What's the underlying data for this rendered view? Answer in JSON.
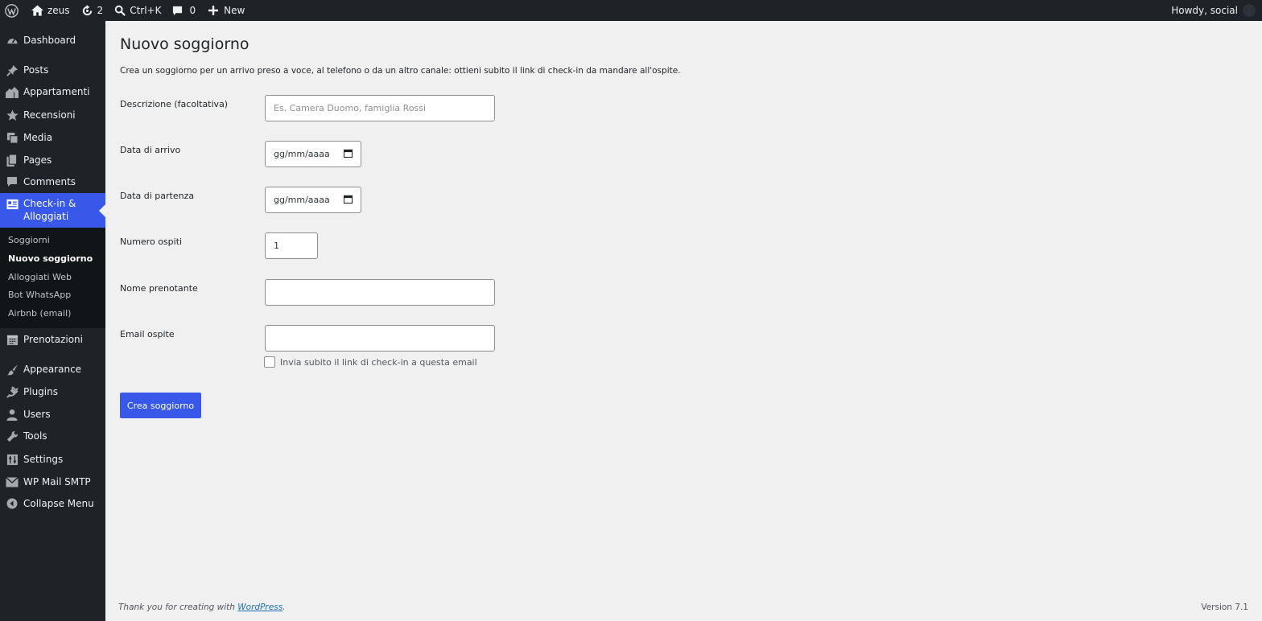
{
  "adminbar": {
    "site_name": "zeus",
    "updates_count": "2",
    "search_shortcut": "Ctrl+K",
    "comments_count": "0",
    "new_label": "New",
    "howdy": "Howdy, social"
  },
  "sidebar": {
    "items": [
      {
        "label": "Dashboard",
        "icon": "dashboard-icon"
      },
      {
        "label": "Posts",
        "icon": "pin-icon"
      },
      {
        "label": "Appartamenti",
        "icon": "buildings-icon"
      },
      {
        "label": "Recensioni",
        "icon": "star-icon"
      },
      {
        "label": "Media",
        "icon": "media-icon"
      },
      {
        "label": "Pages",
        "icon": "pages-icon"
      },
      {
        "label": "Comments",
        "icon": "comment-icon"
      },
      {
        "label": "Check-in & Alloggiati",
        "icon": "id-card-icon"
      },
      {
        "label": "Prenotazioni",
        "icon": "calendar-icon"
      },
      {
        "label": "Appearance",
        "icon": "brush-icon"
      },
      {
        "label": "Plugins",
        "icon": "plug-icon"
      },
      {
        "label": "Users",
        "icon": "user-icon"
      },
      {
        "label": "Tools",
        "icon": "wrench-icon"
      },
      {
        "label": "Settings",
        "icon": "sliders-icon"
      },
      {
        "label": "WP Mail SMTP",
        "icon": "mail-icon"
      },
      {
        "label": "Collapse Menu",
        "icon": "collapse-icon"
      }
    ],
    "submenu": [
      "Soggiorni",
      "Nuovo soggiorno",
      "Alloggiati Web",
      "Bot WhatsApp",
      "Airbnb (email)"
    ],
    "accent": "#3858e9"
  },
  "main": {
    "title": "Nuovo soggiorno",
    "description": "Crea un soggiorno per un arrivo preso a voce, al telefono o da un altro canale: ottieni subito il link di check-in da mandare all'ospite.",
    "fields": {
      "descrizione_label": "Descrizione (facoltativa)",
      "descrizione_placeholder": "Es. Camera Duomo, famiglia Rossi",
      "arrivo_label": "Data di arrivo",
      "arrivo_value": "gg/mm/aaaa",
      "partenza_label": "Data di partenza",
      "partenza_value": "gg/mm/aaaa",
      "ospiti_label": "Numero ospiti",
      "ospiti_value": "1",
      "nome_label": "Nome prenotante",
      "nome_value": "",
      "email_label": "Email ospite",
      "email_value": "",
      "send_link_label": "Invia subito il link di check-in a questa email"
    },
    "submit_label": "Crea soggiorno"
  },
  "footer": {
    "thanks_prefix": "Thank you for creating with ",
    "thanks_link": "WordPress",
    "thanks_suffix": ".",
    "version": "Version 7.1"
  }
}
